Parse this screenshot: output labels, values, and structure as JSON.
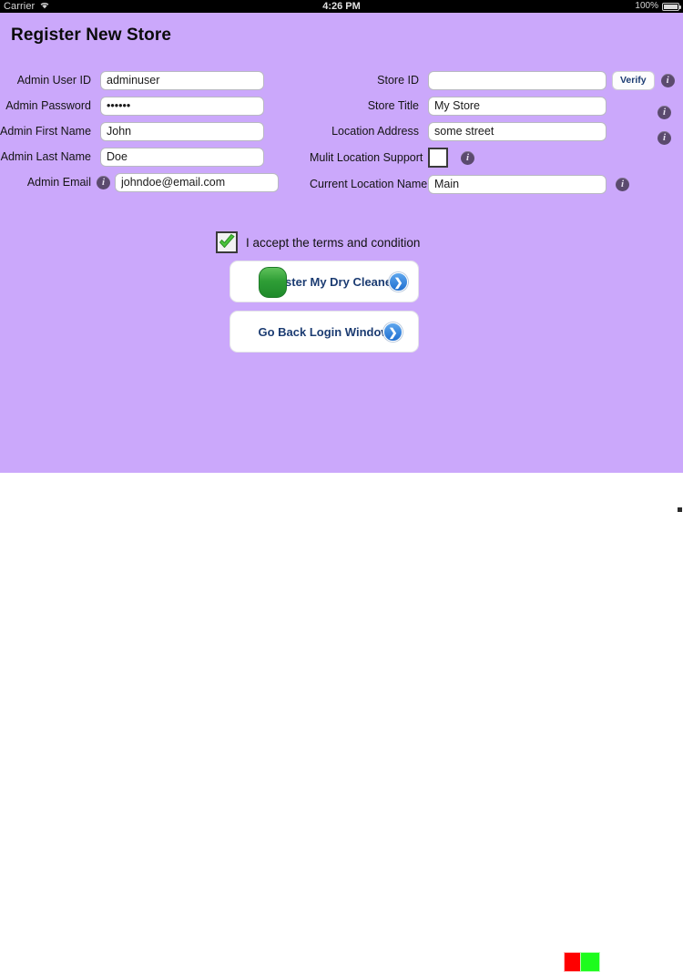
{
  "status_bar": {
    "carrier": "Carrier",
    "wifi_icon": "wifi-icon",
    "time": "4:26 PM",
    "battery_percent": "100%",
    "battery_icon": "battery-icon"
  },
  "page": {
    "title": "Register New Store",
    "background_color": "#cba8fb"
  },
  "left_form": {
    "fields": [
      {
        "label": "Admin  User ID",
        "value": "adminuser",
        "placeholder": "",
        "has_label_info": false,
        "type": "text"
      },
      {
        "label": "Admin Password",
        "value": "••••••",
        "placeholder": "",
        "has_label_info": false,
        "type": "password"
      },
      {
        "label": "Admin First Name",
        "value": "John",
        "placeholder": "",
        "has_label_info": false,
        "type": "text"
      },
      {
        "label": "Admin Last Name",
        "value": "Doe",
        "placeholder": "",
        "has_label_info": false,
        "type": "text"
      },
      {
        "label": "Admin Email",
        "value": "johndoe@email.com",
        "placeholder": "",
        "has_label_info": true,
        "type": "text"
      }
    ]
  },
  "right_form": {
    "fields": [
      {
        "label": "Store ID",
        "value": "",
        "placeholder": "",
        "control": "text",
        "verify_label": "Verify",
        "has_trailing_info": true
      },
      {
        "label": "Store Title",
        "value": "My Store",
        "placeholder": "",
        "control": "text",
        "verify_label": "",
        "has_trailing_info": true
      },
      {
        "label": "Location Address",
        "value": "some street",
        "placeholder": "",
        "control": "text",
        "verify_label": "",
        "has_trailing_info": true
      },
      {
        "label": "Mulit Location Support",
        "value": "",
        "placeholder": "",
        "control": "checkbox",
        "verify_label": "",
        "has_trailing_info": true,
        "checked": false
      },
      {
        "label": "Current Location Name",
        "value": "Main",
        "placeholder": "",
        "control": "text",
        "verify_label": "",
        "has_trailing_info": true
      }
    ]
  },
  "terms": {
    "label": "I accept the terms and condition",
    "checked": true,
    "check_color": "#3fbb2e"
  },
  "buttons": {
    "register": {
      "label": "Register My Dry Cleaner",
      "arrow_glyph": "❯",
      "accent_color": "#2f9e36",
      "text_color": "#1c3c72"
    },
    "go_back": {
      "label": "Go Back Login Window",
      "arrow_glyph": "❯",
      "text_color": "#1c3c72"
    }
  },
  "bottom_bar": {
    "swatches": [
      {
        "name": "red-swatch",
        "color": "#fe0000"
      },
      {
        "name": "green-swatch",
        "color": "#1dfc1d"
      }
    ]
  }
}
